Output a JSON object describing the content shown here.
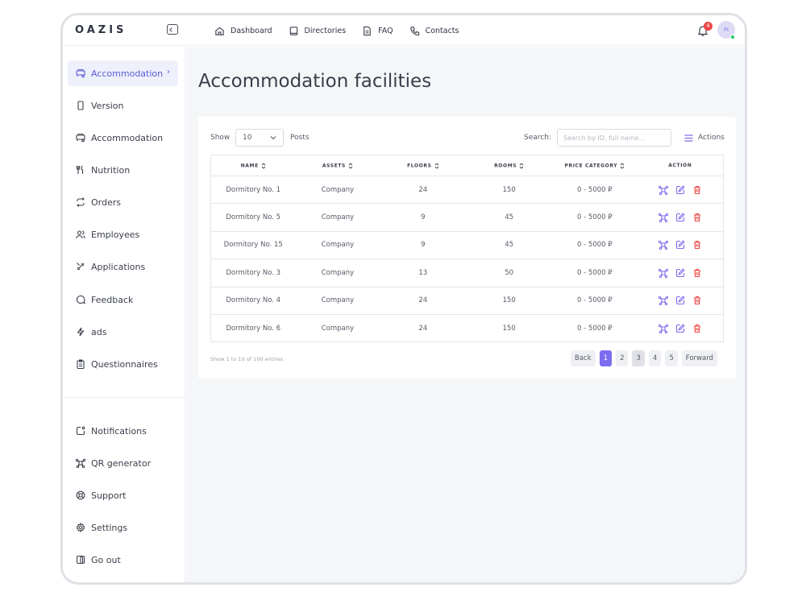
{
  "app": {
    "logo": "OAZIS"
  },
  "topnav": [
    {
      "label": "Dashboard",
      "icon": "home-icon"
    },
    {
      "label": "Directories",
      "icon": "book-icon"
    },
    {
      "label": "FAQ",
      "icon": "document-icon"
    },
    {
      "label": "Contacts",
      "icon": "phone-icon"
    }
  ],
  "notifications": {
    "count": "4"
  },
  "user": {
    "initials": "PI"
  },
  "sidebar": {
    "items": [
      {
        "label": "Accommodation",
        "icon": "building-icon",
        "active": true
      },
      {
        "label": "Version",
        "icon": "phone-device-icon"
      },
      {
        "label": "Accommodation",
        "icon": "building-icon"
      },
      {
        "label": "Nutrition",
        "icon": "utensils-icon"
      },
      {
        "label": "Orders",
        "icon": "repeat-icon"
      },
      {
        "label": "Employees",
        "icon": "users-icon"
      },
      {
        "label": "Applications",
        "icon": "tools-icon"
      },
      {
        "label": "Feedback",
        "icon": "chat-icon"
      },
      {
        "label": "ads",
        "icon": "bolt-icon"
      },
      {
        "label": "Questionnaires",
        "icon": "clipboard-icon"
      }
    ],
    "bottom_items": [
      {
        "label": "Notifications",
        "icon": "notification-icon"
      },
      {
        "label": "QR generator",
        "icon": "qr-icon"
      },
      {
        "label": "Support",
        "icon": "support-icon"
      },
      {
        "label": "Settings",
        "icon": "gear-icon"
      },
      {
        "label": "Go out",
        "icon": "logout-icon"
      }
    ]
  },
  "page": {
    "title": "Accommodation facilities"
  },
  "controls": {
    "show_label": "Show",
    "page_size": "10",
    "posts_label": "Posts",
    "search_label": "Search:",
    "search_placeholder": "Search by ID, full name...",
    "actions_label": "Actions"
  },
  "table": {
    "headers": [
      "Name",
      "Assets",
      "Floors",
      "Rooms",
      "Price category",
      "Action"
    ],
    "rows": [
      {
        "name": "Dormitory No. 1",
        "assets": "Company",
        "floors": "24",
        "rooms": "150",
        "price": "0 - 5000 ₽"
      },
      {
        "name": "Dormitory No. 5",
        "assets": "Company",
        "floors": "9",
        "rooms": "45",
        "price": "0 - 5000 ₽"
      },
      {
        "name": "Dormitory No. 15",
        "assets": "Company",
        "floors": "9",
        "rooms": "45",
        "price": "0 - 5000 ₽"
      },
      {
        "name": "Dormitory No. 3",
        "assets": "Company",
        "floors": "13",
        "rooms": "50",
        "price": "0 - 5000 ₽"
      },
      {
        "name": "Dormitory No. 4",
        "assets": "Company",
        "floors": "24",
        "rooms": "150",
        "price": "0 - 5000 ₽"
      },
      {
        "name": "Dormitory No. 6",
        "assets": "Company",
        "floors": "24",
        "rooms": "150",
        "price": "0 - 5000 ₽"
      }
    ]
  },
  "pagination": {
    "summary": "Show 1 to 10 of 100 entries",
    "back": "Back",
    "pages": [
      "1",
      "2",
      "3",
      "4",
      "5"
    ],
    "current": "1",
    "forward": "Forward"
  },
  "colors": {
    "accent": "#7c6df0",
    "danger": "#ef4444",
    "background": "#f5f6f8"
  }
}
